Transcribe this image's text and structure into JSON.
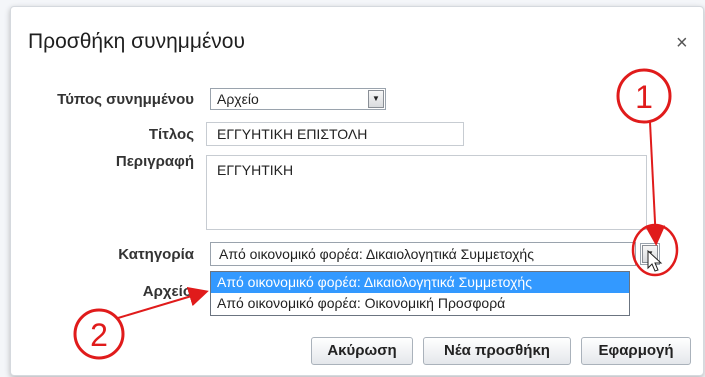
{
  "dialog": {
    "title": "Προσθήκη συνημμένου",
    "close_glyph": "×"
  },
  "fields": {
    "type_label": "Τύπος συνημμένου",
    "type_value": "Αρχείο",
    "title_label": "Τίτλος",
    "title_value": "ΕΓΓΥΗΤΙΚΗ ΕΠΙΣΤΟΛΗ",
    "description_label": "Περιγραφή",
    "description_value": "ΕΓΓΥΗΤΙΚΗ",
    "category_label": "Κατηγορία",
    "category_value": "Από οικονομικό φορέα: Δικαιολογητικά Συμμετοχής",
    "file_label": "Αρχείο"
  },
  "category_options": [
    "Από οικονομικό φορέα: Δικαιολογητικά Συμμετοχής",
    "Από οικονομικό φορέα: Οικονομική Προσφορά"
  ],
  "buttons": {
    "cancel": "Ακύρωση",
    "new_add": "Νέα προσθήκη",
    "apply": "Εφαρμογή"
  },
  "annotations": {
    "callout_1": "1",
    "callout_2": "2",
    "color": "#e01b1b"
  }
}
